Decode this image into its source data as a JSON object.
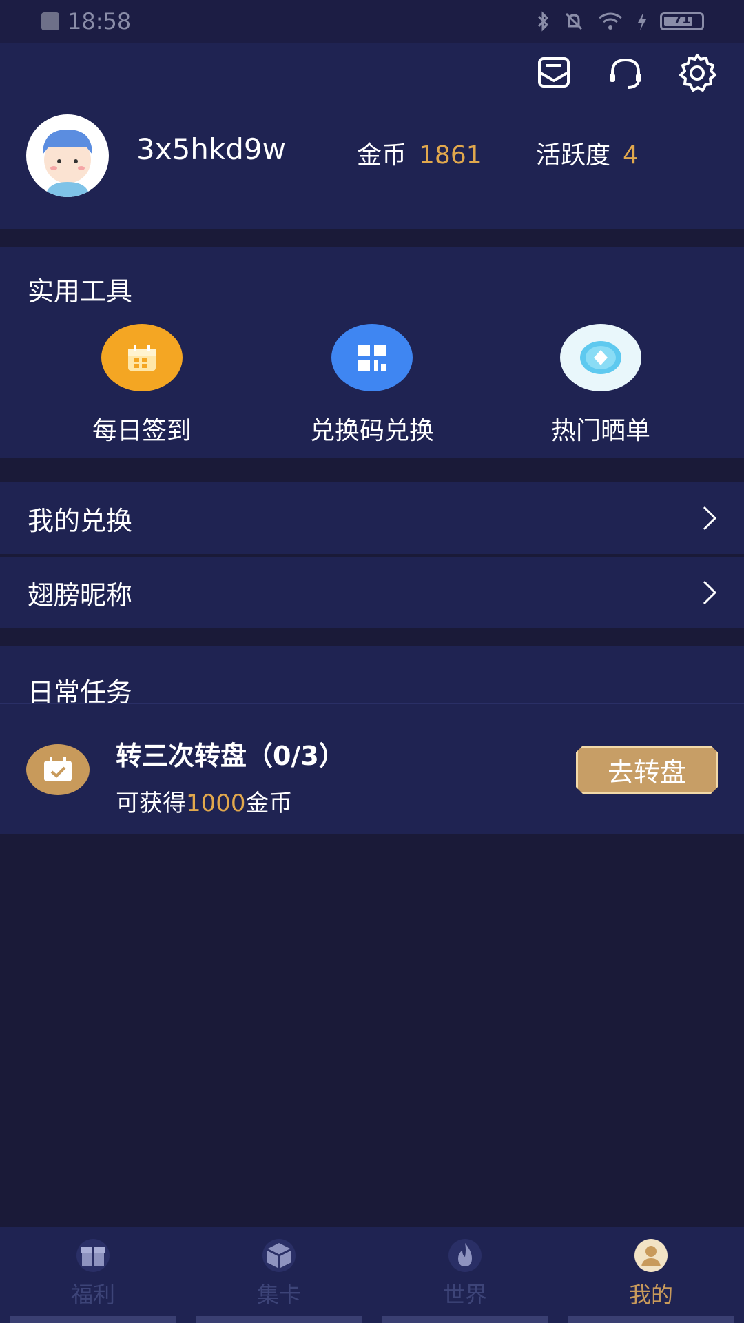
{
  "status_bar": {
    "time": "18:58",
    "battery": "71"
  },
  "profile": {
    "username": "3x5hkd9w",
    "coin_label": "金币",
    "coin_value": "1861",
    "activity_label": "活跃度",
    "activity_value": "4"
  },
  "tools": {
    "title": "实用工具",
    "items": [
      {
        "label": "每日签到",
        "icon": "calendar-gift-icon",
        "color": "#f4a623"
      },
      {
        "label": "兑换码兑换",
        "icon": "qr-code-icon",
        "color": "#3f86f2"
      },
      {
        "label": "热门晒单",
        "icon": "diamond-coin-icon",
        "color": "#e9f7fb"
      }
    ]
  },
  "menu": [
    {
      "label": "我的兑换"
    },
    {
      "label": "翅膀昵称"
    }
  ],
  "tasks": {
    "title": "日常任务",
    "item": {
      "title": "转三次转盘（0/3）",
      "reward_prefix": "可获得",
      "reward_amount": "1000",
      "reward_suffix": "金币",
      "button": "去转盘"
    }
  },
  "bottom_nav": [
    {
      "label": "福利",
      "icon": "gift-icon",
      "active": false
    },
    {
      "label": "集卡",
      "icon": "cube-icon",
      "active": false
    },
    {
      "label": "世界",
      "icon": "fire-icon",
      "active": false
    },
    {
      "label": "我的",
      "icon": "user-icon",
      "active": true
    }
  ],
  "colors": {
    "accent_gold": "#e1a84d",
    "panel": "#1f2352",
    "background": "#1a1a38"
  }
}
